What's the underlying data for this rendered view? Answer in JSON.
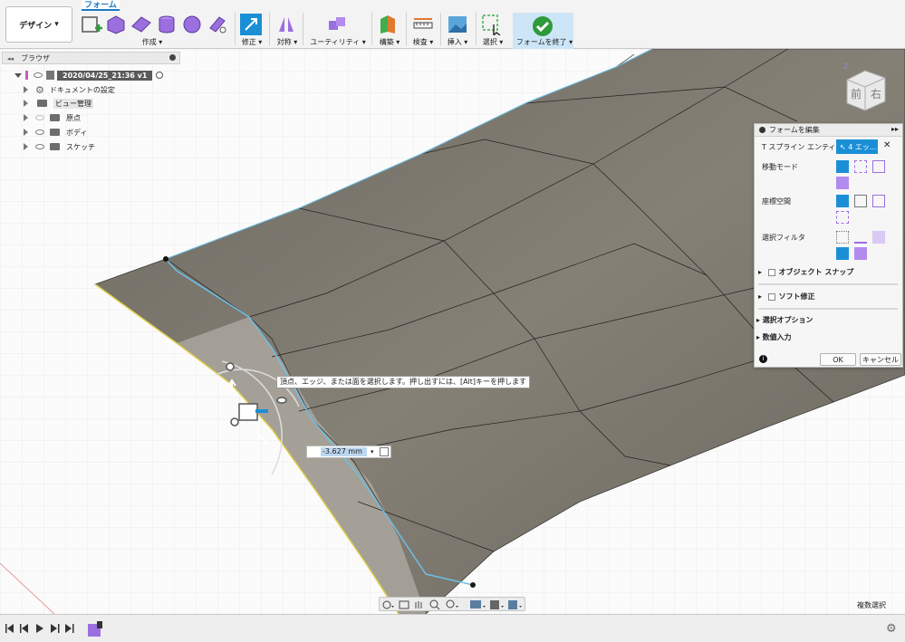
{
  "toolbar": {
    "design_label": "デザイン",
    "form_tab": "フォーム",
    "groups": {
      "create": "作成",
      "modify": "修正",
      "symmetry": "対称",
      "utility": "ユーティリティ",
      "construct": "構築",
      "inspect": "検査",
      "insert": "挿入",
      "select": "選択",
      "finish": "フォームを終了"
    }
  },
  "browser": {
    "title": "ブラウザ",
    "root": "2020/04/25_21:36 v1",
    "items": [
      {
        "label": "ドキュメントの設定"
      },
      {
        "label": "ビュー管理"
      },
      {
        "label": "原点"
      },
      {
        "label": "ボディ"
      },
      {
        "label": "スケッチ"
      }
    ]
  },
  "edit_form": {
    "title": "フォームを編集",
    "tspline_label": "T スプライン エンティ...",
    "tspline_value": "4 エッ...",
    "move_mode": "移動モード",
    "coord_space": "座標空間",
    "select_filter": "選択フィルタ",
    "object_snap": "オブジェクト スナップ",
    "soft_modify": "ソフト修正",
    "select_options": "選択オプション",
    "numeric_input": "数値入力",
    "ok": "OK",
    "cancel": "キャンセル"
  },
  "tooltip": "頂点、エッジ、または面を選択します。押し出すには、[Alt]キーを押します",
  "dimension_value": "-3.627 mm",
  "viewcube": {
    "front": "前",
    "right": "右",
    "z": "Z"
  },
  "status": {
    "multi_select": "複数選択"
  },
  "colors": {
    "accent": "#1b8fd6",
    "surface": "#7c7870",
    "edge_highlight": "#6cc0e8",
    "boundary": "#e3d24a"
  }
}
